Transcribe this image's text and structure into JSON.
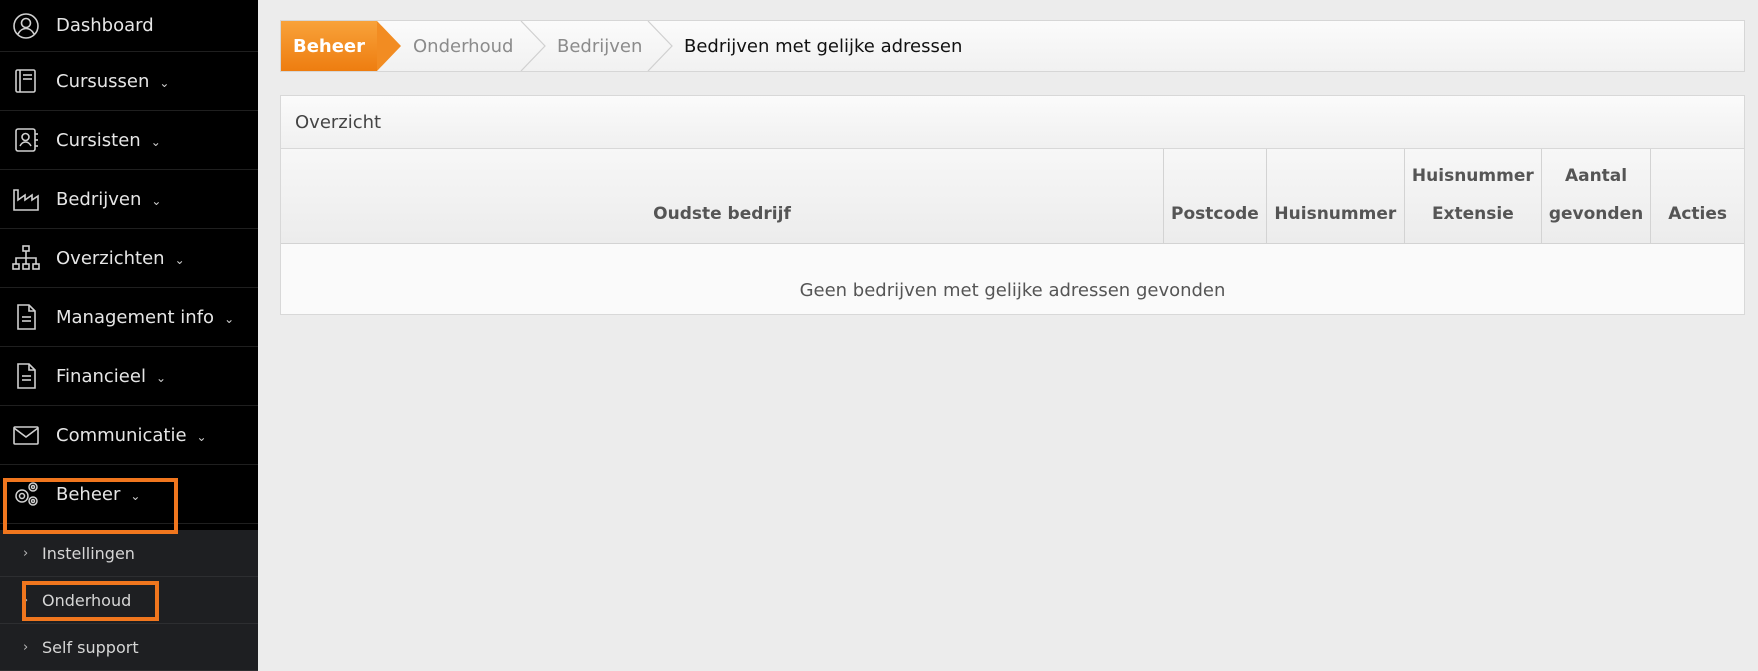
{
  "sidebar": {
    "items": [
      {
        "label": "Dashboard",
        "icon": "user-circle-icon",
        "chevron": false
      },
      {
        "label": "Cursussen",
        "icon": "book-icon",
        "chevron": true
      },
      {
        "label": "Cursisten",
        "icon": "contact-book-icon",
        "chevron": true
      },
      {
        "label": "Bedrijven",
        "icon": "factory-icon",
        "chevron": true
      },
      {
        "label": "Overzichten",
        "icon": "sitemap-icon",
        "chevron": true
      },
      {
        "label": "Management info",
        "icon": "document-icon",
        "chevron": true
      },
      {
        "label": "Financieel",
        "icon": "document-icon",
        "chevron": true
      },
      {
        "label": "Communicatie",
        "icon": "envelope-icon",
        "chevron": true
      },
      {
        "label": "Beheer",
        "icon": "gears-icon",
        "chevron": true
      }
    ],
    "submenu": [
      {
        "label": "Instellingen"
      },
      {
        "label": "Onderhoud"
      },
      {
        "label": "Self support"
      }
    ]
  },
  "breadcrumb": {
    "items": [
      "Beheer",
      "Onderhoud",
      "Bedrijven",
      "Bedrijven met gelijke adressen"
    ]
  },
  "panel": {
    "title": "Overzicht",
    "columns": [
      "Oudste bedrijf",
      "Postcode",
      "Huisnummer",
      "Huisnummer Extensie",
      "Aantal gevonden",
      "Acties"
    ],
    "empty_message": "Geen bedrijven met gelijke adressen gevonden"
  },
  "colors": {
    "accent": "#f28c22",
    "highlight": "#f0761e",
    "sidebar_bg": "#000000",
    "submenu_bg": "#1e1f22"
  }
}
